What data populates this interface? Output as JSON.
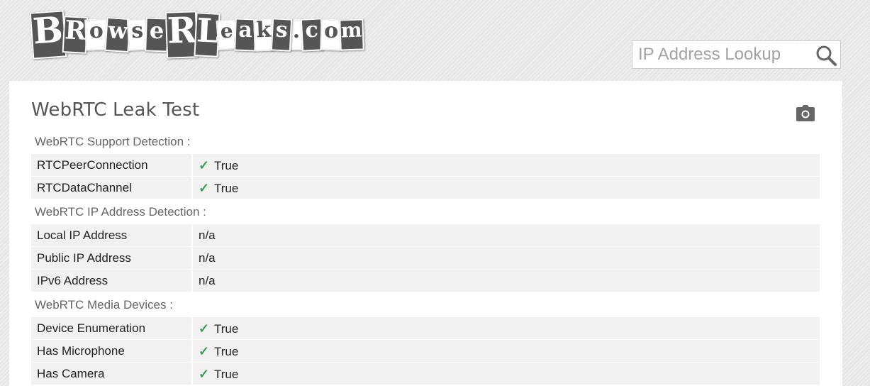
{
  "brand": {
    "logo_text": "BrowserLeaks.com"
  },
  "search": {
    "placeholder": "IP Address Lookup"
  },
  "page": {
    "title": "WebRTC Leak Test",
    "sections": [
      {
        "heading": "WebRTC Support Detection :",
        "rows": [
          {
            "label": "RTCPeerConnection",
            "value": "True",
            "icon": "check-icon"
          },
          {
            "label": "RTCDataChannel",
            "value": "True",
            "icon": "check-icon"
          }
        ]
      },
      {
        "heading": "WebRTC IP Address Detection :",
        "rows": [
          {
            "label": "Local IP Address",
            "value": "n/a"
          },
          {
            "label": "Public IP Address",
            "value": "n/a"
          },
          {
            "label": "IPv6 Address",
            "value": "n/a"
          }
        ]
      },
      {
        "heading": "WebRTC Media Devices :",
        "rows": [
          {
            "label": "Device Enumeration",
            "value": "True",
            "icon": "check-icon"
          },
          {
            "label": "Has Microphone",
            "value": "True",
            "icon": "check-icon"
          },
          {
            "label": "Has Camera",
            "value": "True",
            "icon": "check-icon"
          }
        ]
      }
    ]
  },
  "colors": {
    "check": "#3a9e52",
    "row_bg": "#f1f1f1",
    "logo_dark": "#555555"
  }
}
